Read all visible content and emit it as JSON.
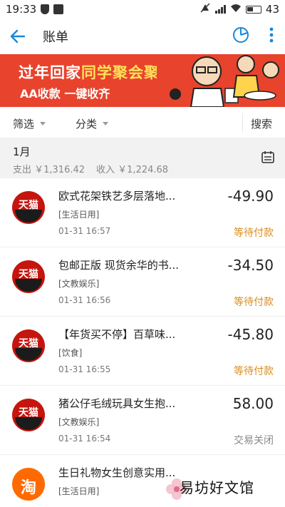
{
  "status_bar": {
    "time": "19:33",
    "battery": "43"
  },
  "header": {
    "title": "账单"
  },
  "banner": {
    "line1_white": "过年回家",
    "line1_highlight": "同学聚会聚餐",
    "line2": "AA收款  一键收齐"
  },
  "filters": {
    "filter_label": "筛选",
    "category_label": "分类",
    "search_label": "搜索"
  },
  "month": {
    "label": "1月",
    "expense": "支出 ￥1,316.42",
    "income": "收入 ￥1,224.68"
  },
  "transactions": [
    {
      "name": "欧式花架铁艺多层落地...",
      "category": "[生活日用]",
      "datetime": "01-31   16:57",
      "amount": "-49.90",
      "status": "等待付款",
      "logo": "天猫"
    },
    {
      "name": "包邮正版 现货余华的书...",
      "category": "[文教娱乐]",
      "datetime": "01-31   16:56",
      "amount": "-34.50",
      "status": "等待付款",
      "logo": "天猫"
    },
    {
      "name": "【年货买不停】百草味...",
      "category": "[饮食]",
      "datetime": "01-31   16:55",
      "amount": "-45.80",
      "status": "等待付款",
      "logo": "天猫"
    },
    {
      "name": "猪公仔毛绒玩具女生抱...",
      "category": "[文教娱乐]",
      "datetime": "01-31   16:54",
      "amount": "58.00",
      "status": "交易关闭",
      "logo": "天猫"
    },
    {
      "name": "生日礼物女生创意实用...",
      "category": "[生活日用]",
      "datetime": "",
      "amount": "",
      "status": "",
      "logo": "淘"
    }
  ],
  "watermark": {
    "text": "易坊好文馆"
  },
  "colors": {
    "accent": "#1a87d9",
    "banner_bg": "#e8432d",
    "pending": "#d98c1c"
  }
}
